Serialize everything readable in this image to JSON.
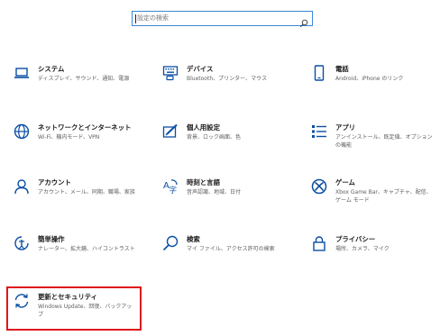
{
  "search": {
    "placeholder": "設定の検索",
    "icon": "search-icon"
  },
  "accent_color": "#0a4ea3",
  "highlight_color": "#e0151c",
  "tiles": [
    {
      "title": "システム",
      "desc": "ディスプレイ、サウンド、通知、電源",
      "icon": "laptop-icon"
    },
    {
      "title": "デバイス",
      "desc": "Bluetooth、プリンター、マウス",
      "icon": "keyboard-icon"
    },
    {
      "title": "電話",
      "desc": "Android、iPhone のリンク",
      "icon": "phone-icon"
    },
    {
      "title": "ネットワークとインターネット",
      "desc": "Wi-Fi、機内モード、VPN",
      "icon": "globe-icon"
    },
    {
      "title": "個人用設定",
      "desc": "背景、ロック画面、色",
      "icon": "pen-tablet-icon"
    },
    {
      "title": "アプリ",
      "desc": "アンインストール、既定値、オプションの機能",
      "icon": "app-list-icon"
    },
    {
      "title": "アカウント",
      "desc": "アカウント、メール、同期、職場、家族",
      "icon": "person-icon"
    },
    {
      "title": "時刻と言語",
      "desc": "音声認識、地域、日付",
      "icon": "time-language-icon"
    },
    {
      "title": "ゲーム",
      "desc": "Xbox Game Bar、キャプチャ、配信、ゲーム モード",
      "icon": "xbox-icon"
    },
    {
      "title": "簡単操作",
      "desc": "ナレーター、拡大鏡、ハイコントラスト",
      "icon": "ease-of-access-icon"
    },
    {
      "title": "検索",
      "desc": "マイ ファイル、アクセス許可の検索",
      "icon": "magnifier-icon"
    },
    {
      "title": "プライバシー",
      "desc": "場所、カメラ、マイク",
      "icon": "lock-icon"
    },
    {
      "title": "更新とセキュリティ",
      "desc": "Windows Update、回復、バックアップ",
      "icon": "sync-icon"
    }
  ]
}
